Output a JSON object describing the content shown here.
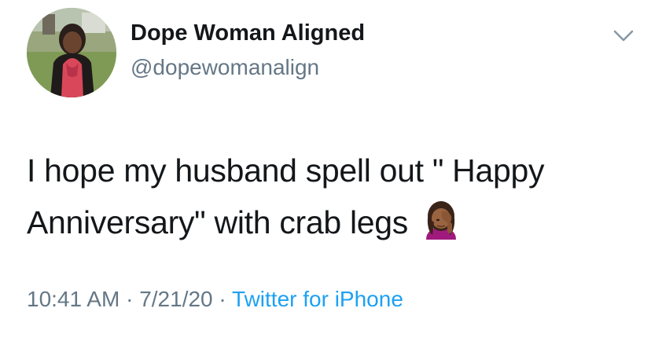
{
  "author": {
    "display_name": "Dope Woman Aligned",
    "handle": "@dopewomanalign"
  },
  "tweet": {
    "text_line1": "I hope my husband spell out \" Happy",
    "text_line2": "Anniversary\" with crab legs",
    "emoji": "woman-facepalming-emoji"
  },
  "meta": {
    "time": "10:41 AM",
    "sep1": " · ",
    "date": "7/21/20",
    "sep2": " · ",
    "source": "Twitter for iPhone"
  },
  "icons": {
    "menu": "chevron-down-icon"
  },
  "colors": {
    "text": "#14171a",
    "secondary": "#657786",
    "link": "#1da1f2"
  }
}
